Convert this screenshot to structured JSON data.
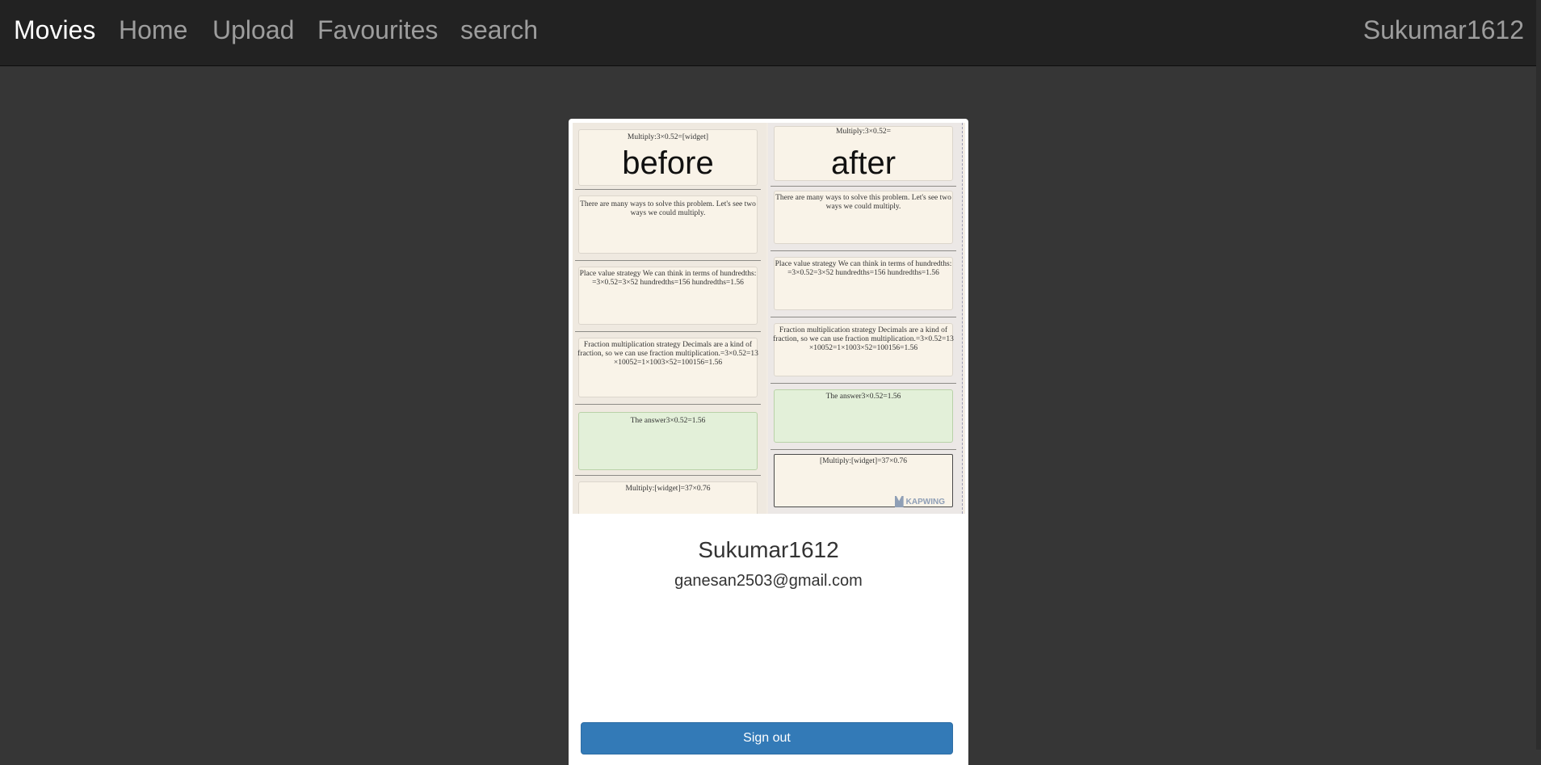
{
  "navbar": {
    "brand": "Movies",
    "links": [
      "Home",
      "Upload",
      "Favourites",
      "search"
    ],
    "user": "Sukumar1612"
  },
  "profile": {
    "thumbnail": {
      "before_label": "before",
      "after_label": "after",
      "left": {
        "title": "Multiply:3×0.52=[widget]",
        "p1": "There are many ways to solve this problem. Let's see two ways we could multiply.",
        "p2": "Place value strategy We can think in terms of hundredths: =3×0.52=3×52 hundredths=156 hundredths=1.56",
        "p3": "Fraction multiplication strategy Decimals are a kind of fraction, so we can use fraction multiplication.=3×0.52=13 ×10052=1×1003×52=100156=1.56",
        "p4": "The answer3×0.52=1.56",
        "p5": "Multiply:[widget]=37×0.76"
      },
      "right": {
        "title": "Multiply:3×0.52=",
        "p1": "There are many ways to solve this problem. Let's see two ways we could multiply.",
        "p2": "Place value strategy We can think in terms of hundredths: =3×0.52=3×52 hundredths=156 hundredths=1.56",
        "p3": "Fraction multiplication strategy Decimals are a kind of fraction, so we can use fraction multiplication.=3×0.52=13 ×10052=1×1003×52=100156=1.56",
        "p4": "The answer3×0.52=1.56",
        "p5": "[Multiply:[widget]=37×0.76"
      },
      "watermark": "KAPWING"
    },
    "username": "Sukumar1612",
    "email": "ganesan2503@gmail.com",
    "signout_label": "Sign out"
  }
}
